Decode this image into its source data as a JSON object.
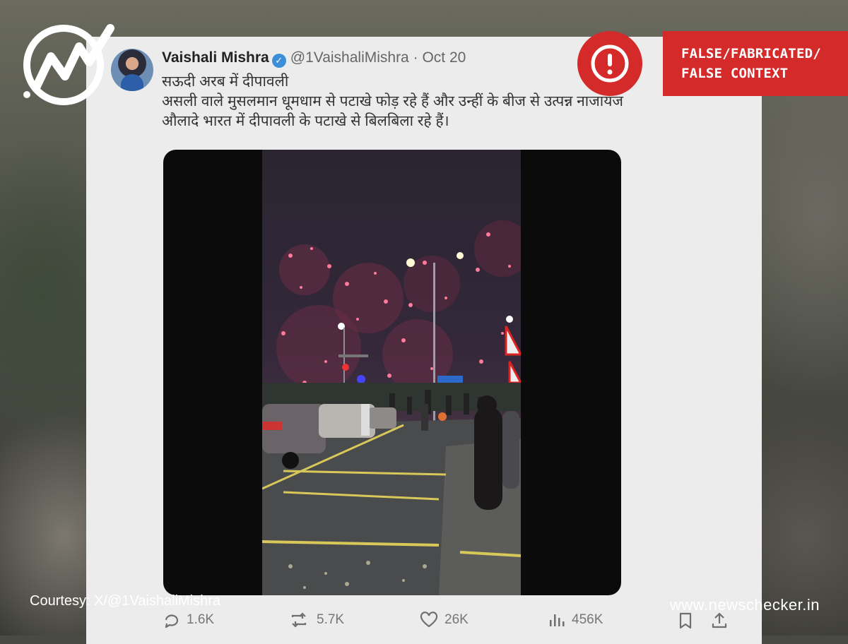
{
  "author": {
    "name": "Vaishali Mishra",
    "handle": "@1VaishaliMishra",
    "separator": "·",
    "date": "Oct 20"
  },
  "tweet": {
    "lines": [
      "सऊदी अरब में दीपावली",
      "असली वाले मुसलमान धूमधाम से पटाखे फोड़ रहे हैं और उन्हीं के बीज से उत्पन्न नाजायज",
      "औलादे भारत में दीपावली के पटाखे से बिलबिला रहे हैं।"
    ]
  },
  "verdict": {
    "line1": "FALSE/FABRICATED/",
    "line2": "FALSE CONTEXT",
    "color": "#d42a2a"
  },
  "courtesy": "Courtesy: X/@1VaishaliMishra",
  "site": "www.newschecker.in",
  "actions": {
    "replies": "1.6K",
    "reposts": "5.7K",
    "likes": "26K",
    "views": "456K"
  },
  "icons": [
    "reply-icon",
    "repost-icon",
    "like-icon",
    "views-icon",
    "bookmark-icon",
    "share-icon",
    "verified-icon",
    "alert-icon",
    "newschecker-logo"
  ]
}
